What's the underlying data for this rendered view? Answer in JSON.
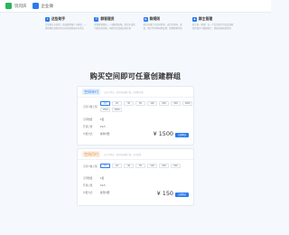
{
  "topbar": {
    "brand1": "玩司庆",
    "brand2": "企业微"
  },
  "features": [
    {
      "title": "这些助手",
      "desc": "企业都可以使用，高效管理客户与群组，一键创建任意群组并自动分配群成员与群主"
    },
    {
      "title": "群管理员",
      "desc": "新增群管理员，一键配置权限，提供丰富的社群运营功能，帮助企业高效运营社群"
    },
    {
      "title": "群规则",
      "desc": "群内违规行为自动检测，支持关键词、链接、图片等多种规则设置，保障群聊环境"
    },
    {
      "title": "群主管理",
      "desc": "群主统一管理，在一个后台即可完成全部群组的维护与数据统计，轻松掌握运营情况"
    }
  ],
  "headline": "购买空间即可任意创建群组",
  "plans": [
    {
      "tag": "空间年付",
      "note": "以年为单位，按空间容量计费，长期更优惠",
      "label_capacity": "空间人数上限",
      "chips": [
        "10",
        "20",
        "30",
        "50",
        "100",
        "200",
        "500",
        "1000",
        "1500",
        "2000"
      ],
      "active": 0,
      "label_count": "空间数量",
      "count": "1套",
      "label_limit": "开通上限",
      "limit": "10人",
      "label_period": "付费方式",
      "period": "按年付费",
      "price": "¥ 1500",
      "buy": "立即购买"
    },
    {
      "tag": "空间月付",
      "note": "以月为单位，按空间容量计费，灵活使用",
      "label_capacity": "空间人数上限",
      "chips": [
        "10",
        "20",
        "30",
        "50",
        "100",
        "200",
        "500"
      ],
      "active": 0,
      "label_count": "空间数量",
      "count": "1套",
      "label_limit": "开通上限",
      "limit": "10人",
      "label_period": "付费方式",
      "period": "按月付费",
      "price": "¥ 150",
      "buy": "立即购买"
    }
  ],
  "colors": {
    "accent": "#2a7bf0",
    "brand_green": "#29b55a",
    "tag_blue_bg": "#e6f0fd",
    "tag_orange_bg": "#fdf0e4"
  }
}
